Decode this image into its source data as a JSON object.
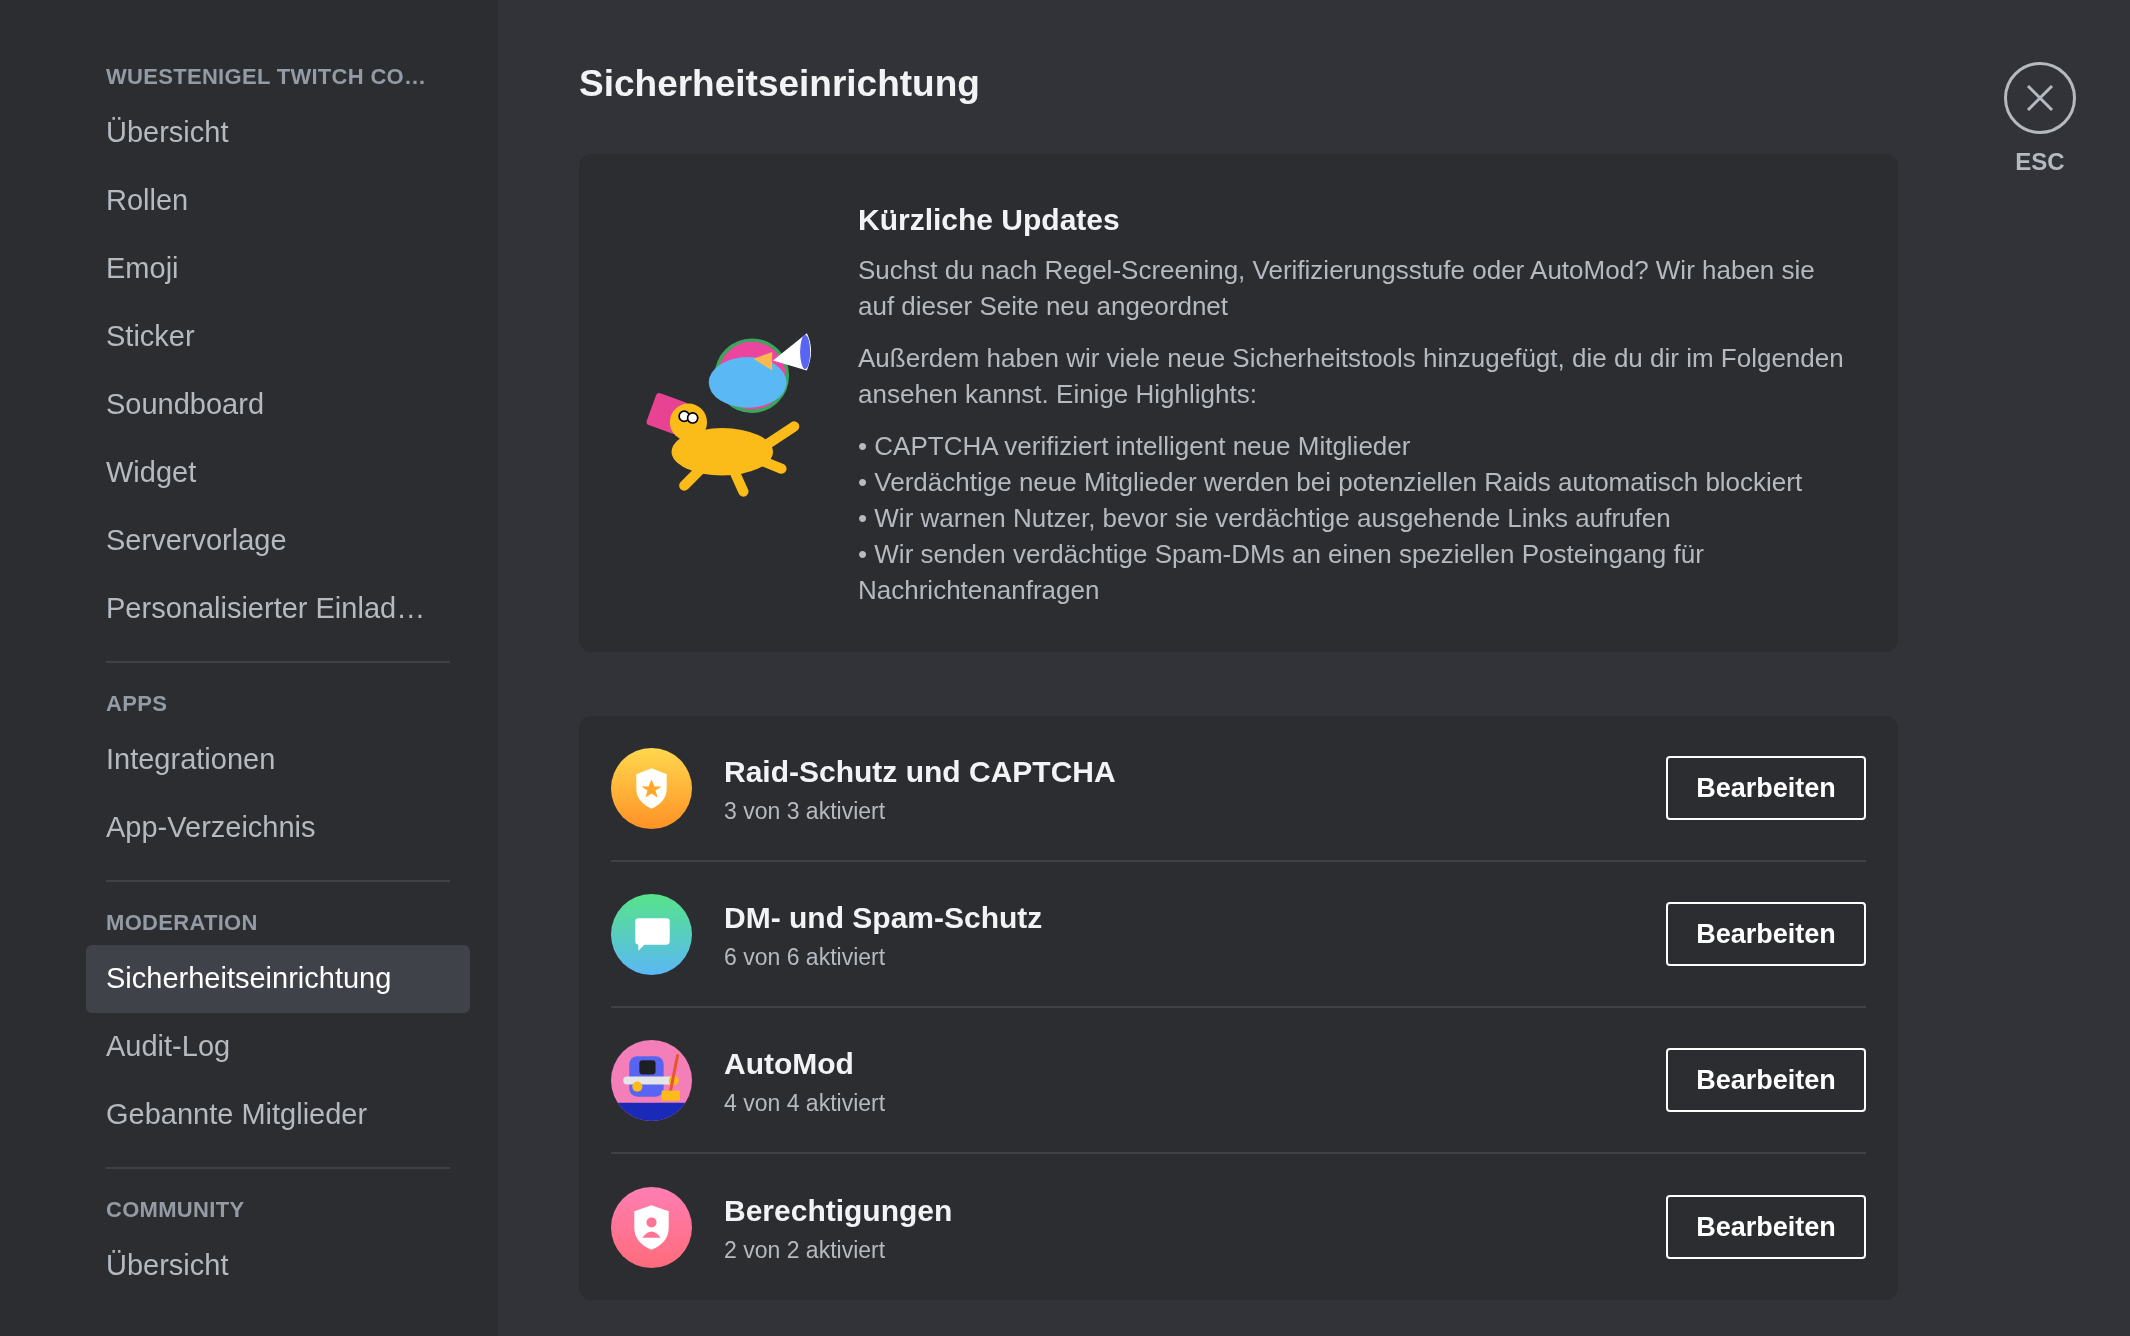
{
  "sidebar": {
    "sections": [
      {
        "header": "WUESTENIGEL TWITCH CO…",
        "items": [
          {
            "label": "Übersicht",
            "selected": false
          },
          {
            "label": "Rollen",
            "selected": false
          },
          {
            "label": "Emoji",
            "selected": false
          },
          {
            "label": "Sticker",
            "selected": false
          },
          {
            "label": "Soundboard",
            "selected": false
          },
          {
            "label": "Widget",
            "selected": false
          },
          {
            "label": "Servervorlage",
            "selected": false
          },
          {
            "label": "Personalisierter Einlad…",
            "selected": false
          }
        ]
      },
      {
        "header": "APPS",
        "items": [
          {
            "label": "Integrationen",
            "selected": false
          },
          {
            "label": "App-Verzeichnis",
            "selected": false
          }
        ]
      },
      {
        "header": "MODERATION",
        "items": [
          {
            "label": "Sicherheitseinrichtung",
            "selected": true
          },
          {
            "label": "Audit-Log",
            "selected": false
          },
          {
            "label": "Gebannte Mitglieder",
            "selected": false
          }
        ]
      },
      {
        "header": "COMMUNITY",
        "items": [
          {
            "label": "Übersicht",
            "selected": false
          }
        ]
      }
    ]
  },
  "page": {
    "title": "Sicherheitseinrichtung"
  },
  "updates": {
    "title": "Kürzliche Updates",
    "paragraphs": [
      "Suchst du nach Regel-Screening, Verifizierungsstufe oder AutoMod? Wir haben sie auf dieser Seite neu angeordnet",
      "Außerdem haben wir viele neue Sicherheitstools hinzugefügt, die du dir im Folgenden ansehen kannst. Einige Highlights:"
    ],
    "bullets": [
      "• CAPTCHA verifiziert intelligent neue Mitglieder",
      "• Verdächtige neue Mitglieder werden bei potenziellen Raids automatisch blockiert",
      "• Wir warnen Nutzer, bevor sie verdächtige ausgehende Links aufrufen",
      "• Wir senden verdächtige Spam-DMs an einen speziellen Posteingang für Nachrichtenanfragen"
    ]
  },
  "features": [
    {
      "kind": "shield-star",
      "title": "Raid-Schutz und CAPTCHA",
      "subtitle": "3 von 3 aktiviert",
      "button": "Bearbeiten"
    },
    {
      "kind": "chat",
      "title": "DM- und Spam-Schutz",
      "subtitle": "6 von 6 aktiviert",
      "button": "Bearbeiten"
    },
    {
      "kind": "robot",
      "title": "AutoMod",
      "subtitle": "4 von 4 aktiviert",
      "button": "Bearbeiten"
    },
    {
      "kind": "shield-person",
      "title": "Berechtigungen",
      "subtitle": "2 von 2 aktiviert",
      "button": "Bearbeiten"
    }
  ],
  "close": {
    "label": "ESC"
  }
}
